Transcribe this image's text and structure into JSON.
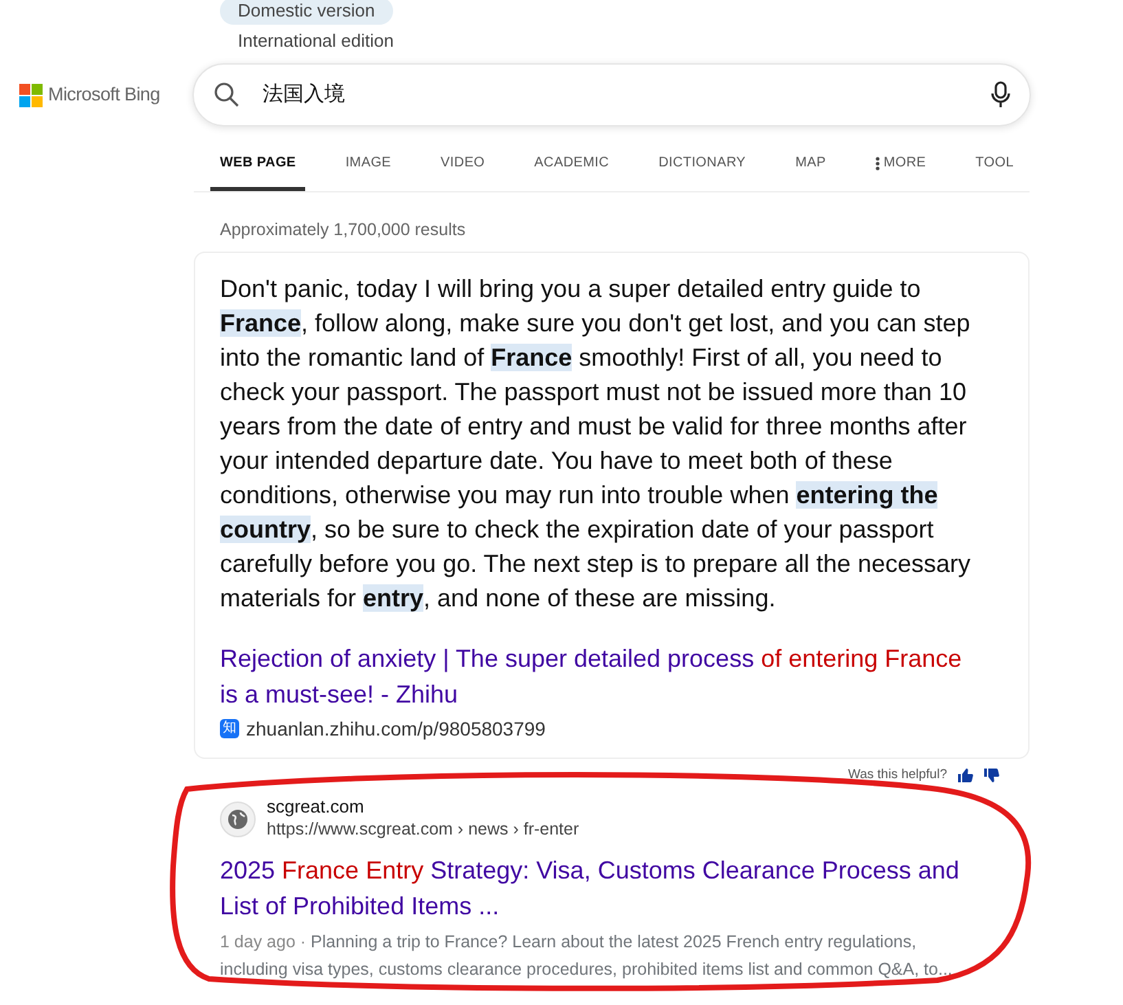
{
  "version_menu": [
    {
      "label": "Domestic version",
      "selected": true
    },
    {
      "label": "International edition",
      "selected": false
    }
  ],
  "logo": {
    "text": "Microsoft Bing"
  },
  "search": {
    "value": "法国入境"
  },
  "tabs": [
    {
      "label": "WEB PAGE",
      "selected": true
    },
    {
      "label": "IMAGE",
      "selected": false
    },
    {
      "label": "VIDEO",
      "selected": false
    },
    {
      "label": "ACADEMIC",
      "selected": false
    },
    {
      "label": "DICTIONARY",
      "selected": false
    },
    {
      "label": "MAP",
      "selected": false
    },
    {
      "label": "MORE",
      "selected": false,
      "kind": "menu"
    },
    {
      "label": "TOOL",
      "selected": false
    }
  ],
  "result_count": "Approximately 1,700,000 results",
  "answer": {
    "text": "Don't panic, today I will bring you a super detailed entry guide to **France**, follow along, make sure you don't get lost, and you can step into the romantic land of **France** smoothly! First of all, you need to check your passport. The passport must not be issued more than 10 years from the date of entry and must be valid for three months after your intended departure date. You have to meet both of these conditions, otherwise you may run into trouble when **entering the country**, so be sure to check the expiration date of your passport carefully before you go. The next step is to prepare all the necessary materials for **entry**, and none of these are missing.",
    "title": [
      {
        "text": "Rejection of anxiety | The super detailed process ",
        "highlight": false
      },
      {
        "text": "of entering France",
        "highlight": true
      },
      {
        "text": " is a must-see! - Zhihu",
        "highlight": false
      }
    ],
    "favicon": "知",
    "url": "zhuanlan.zhihu.com/p/9805803799"
  },
  "feedback": {
    "label": "Was this helpful?"
  },
  "results": [
    {
      "site": "scgreat.com",
      "url": "https://www.scgreat.com › news › fr-enter",
      "title": [
        {
          "text": "2025 ",
          "highlight": false
        },
        {
          "text": "France Entry",
          "highlight": true
        },
        {
          "text": " Strategy: Visa, Customs Clearance Process and List of Prohibited Items ...",
          "highlight": false
        }
      ],
      "date": "1 day ago · ",
      "snippet": "Planning a trip to France? Learn about the latest 2025 French entry regulations, including visa types, customs clearance procedures, prohibited items list and common Q&A, to..."
    }
  ]
}
